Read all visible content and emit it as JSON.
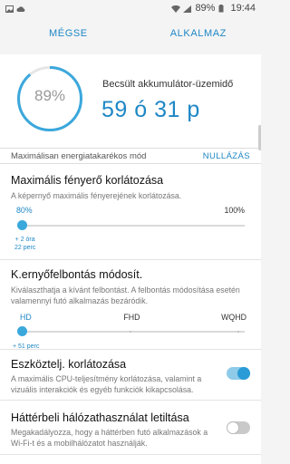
{
  "status_bar": {
    "battery": "89%",
    "time": "19:44",
    "icons": [
      "image-icon",
      "cloud-icon",
      "wifi-icon",
      "signal-icon",
      "battery-icon"
    ]
  },
  "action_bar": {
    "cancel_label": "MÉGSE",
    "apply_label": "ALKALMAZ"
  },
  "battery": {
    "percent_text": "89%",
    "percent_value": 0.89,
    "estimate_label": "Becsült akkumulátor-üzemidő",
    "estimate_value": "59 ó 31 p"
  },
  "mode": {
    "name": "Maximálisan energiatakarékos mód",
    "reset_label": "NULLÁZÁS"
  },
  "brightness": {
    "title": "Maximális fényerő korlátozása",
    "description": "A képernyő maximális fényerejének korlátozása.",
    "min_label": "80%",
    "max_label": "100%",
    "gain_line1": "+ 2 óra",
    "gain_line2": "22 perc",
    "value_fraction": 0
  },
  "resolution": {
    "title": "K.ernyőfelbontás módosít.",
    "description": "Kiválaszthatja a kívánt felbontást. A felbontás módosítása esetén valamennyi futó alkalmazás bezáródik.",
    "options": [
      "HD",
      "FHD",
      "WQHD"
    ],
    "selected": "HD",
    "gain": "+ 51 perc"
  },
  "cpu_limit": {
    "title": "Eszköztelj. korlátozása",
    "description": "A maximális CPU-teljesítmény korlátozása, valamint a vizuális interakciók és egyéb funkciók kikapcsolása.",
    "enabled": true
  },
  "background_network": {
    "title": "Háttérbeli hálózathasználat letiltása",
    "description": "Megakadályozza, hogy a háttérben futó alkalmazások a Wi-Fi-t és a mobilhálózatot használják.",
    "enabled": false
  },
  "colors": {
    "accent": "#1e87c6",
    "slider_thumb": "#3ba8dc",
    "toggle_on": "#2a9bd6"
  }
}
